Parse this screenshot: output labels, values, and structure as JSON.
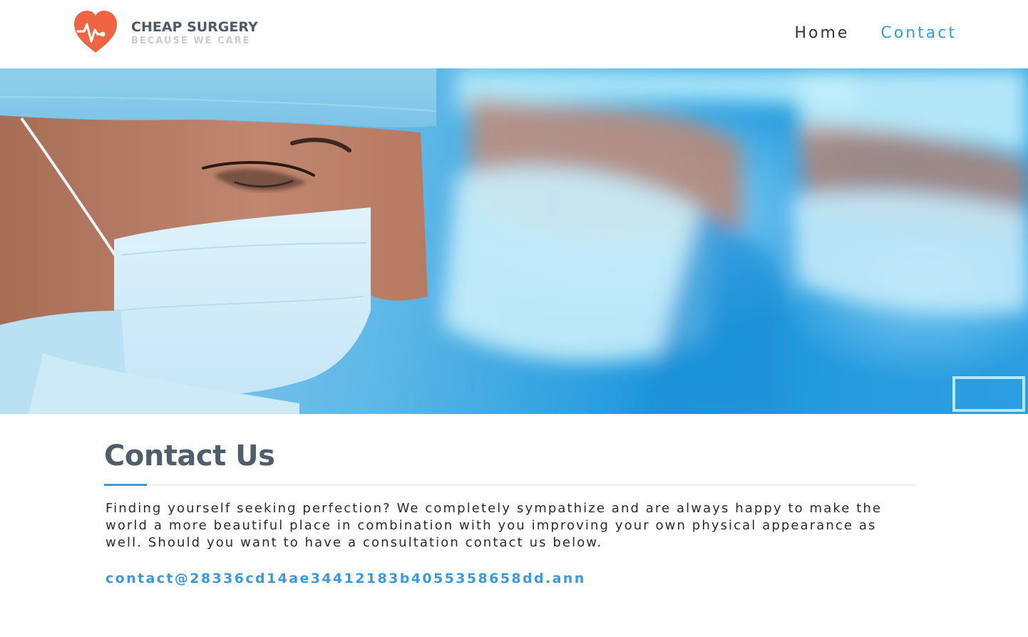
{
  "brand": {
    "name": "CHEAP SURGERY",
    "tagline": "BECAUSE WE CARE",
    "logo_icon": "heart-pulse-icon",
    "logo_color": "#ef6443"
  },
  "nav": {
    "items": [
      {
        "label": "Home",
        "active": false
      },
      {
        "label": "Contact",
        "active": true
      }
    ]
  },
  "hero": {
    "image": "surgeons-in-masks-photo",
    "slider_button_label": ""
  },
  "main": {
    "title": "Contact Us",
    "intro": "Finding yourself seeking perfection? We completely sympathize and are always happy to make the world a more beautiful place in combination with you improving your own physical appearance as well. Should you want to have a consultation contact us below.",
    "email": "contact@28336cd14ae34412183b4055358658dd.ann"
  },
  "colors": {
    "accent": "#3d99dd",
    "title": "#505e6b",
    "logo": "#ef6443"
  }
}
